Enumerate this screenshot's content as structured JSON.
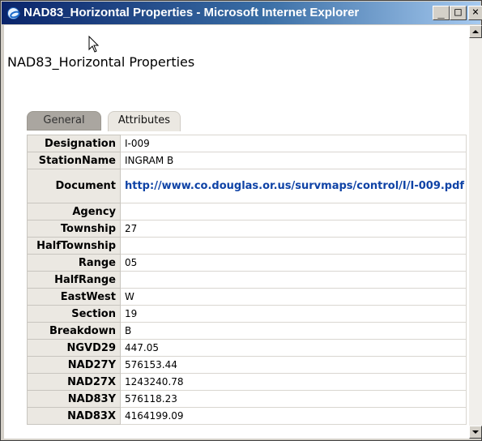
{
  "window": {
    "title": "NAD83_Horizontal Properties - Microsoft Internet Explorer",
    "minimize_label": "_",
    "maximize_label": "□",
    "close_label": "×"
  },
  "page": {
    "title": "NAD83_Horizontal Properties",
    "tabs": [
      {
        "label": "General",
        "active": false
      },
      {
        "label": "Attributes",
        "active": true
      }
    ]
  },
  "attributes": [
    {
      "name": "Designation",
      "value": "I-009"
    },
    {
      "name": "StationName",
      "value": "INGRAM B"
    },
    {
      "name": "Document",
      "value": "http://www.co.douglas.or.us/survmaps/control/I/I-009.pdf",
      "link": true
    },
    {
      "name": "Agency",
      "value": ""
    },
    {
      "name": "Township",
      "value": "27"
    },
    {
      "name": "HalfTownship",
      "value": ""
    },
    {
      "name": "Range",
      "value": "05"
    },
    {
      "name": "HalfRange",
      "value": ""
    },
    {
      "name": "EastWest",
      "value": "W"
    },
    {
      "name": "Section",
      "value": "19"
    },
    {
      "name": "Breakdown",
      "value": "B"
    },
    {
      "name": "NGVD29",
      "value": "447.05"
    },
    {
      "name": "NAD27Y",
      "value": "576153.44"
    },
    {
      "name": "NAD27X",
      "value": "1243240.78"
    },
    {
      "name": "NAD83Y",
      "value": "576118.23"
    },
    {
      "name": "NAD83X",
      "value": "4164199.09"
    }
  ],
  "colors": {
    "titlebar": "#0a246a",
    "link": "#0f43a6"
  },
  "icons": [
    "ie-icon",
    "minimize-icon",
    "maximize-icon",
    "close-icon",
    "scroll-up-icon",
    "scroll-down-icon",
    "mouse-cursor-icon"
  ]
}
